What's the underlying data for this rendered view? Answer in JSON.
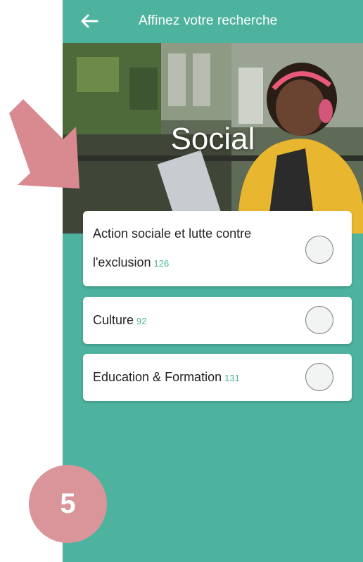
{
  "header": {
    "back_icon": "arrow-left-icon",
    "title": "Affinez votre recherche"
  },
  "hero": {
    "title": "Social"
  },
  "options": [
    {
      "label_line1": "Action sociale et lutte contre",
      "label_line2": "l'exclusion",
      "count": "126",
      "selected": false
    },
    {
      "label": "Culture",
      "count": "92",
      "selected": false
    },
    {
      "label": "Education & Formation",
      "count": "131",
      "selected": false
    }
  ],
  "annotation": {
    "arrow_icon": "arrow-down-right-icon",
    "step_number": "5"
  },
  "colors": {
    "accent": "#4db39f",
    "annotation": "#d9959a"
  }
}
